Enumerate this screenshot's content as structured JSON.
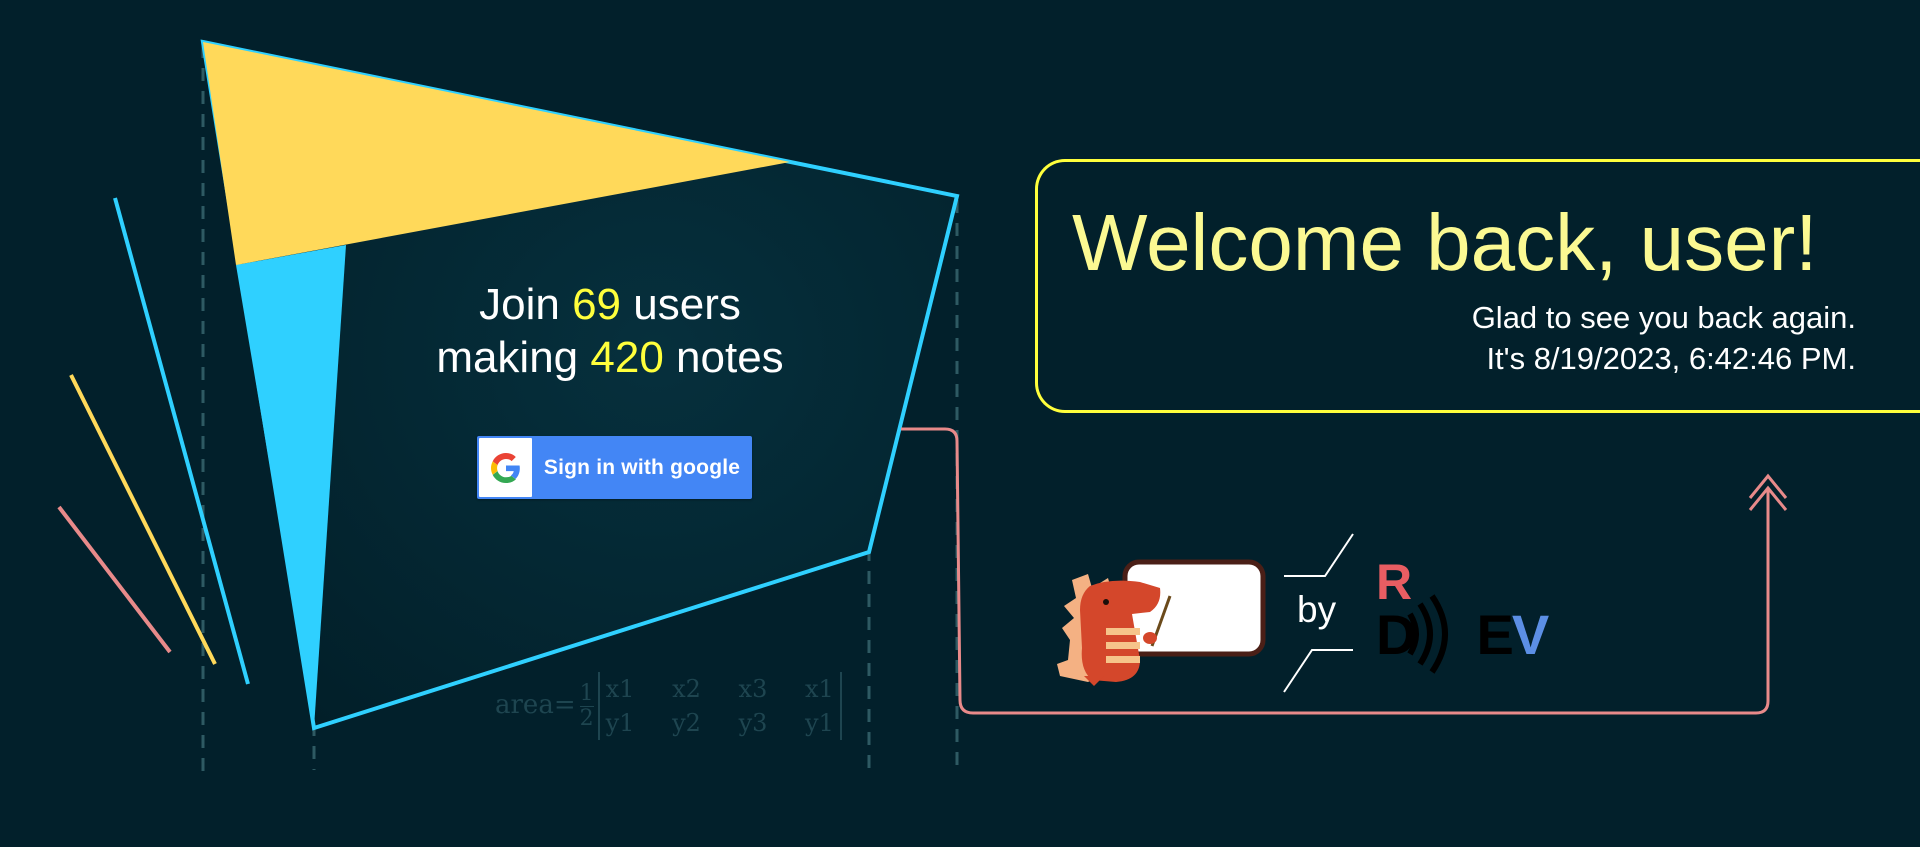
{
  "hero": {
    "join_prefix": "Join",
    "users_count": "69",
    "users_suffix": "users",
    "making_prefix": "making",
    "notes_count": "420",
    "notes_suffix": "notes"
  },
  "signin": {
    "label": "Sign in with google",
    "icon": "google-g-icon"
  },
  "welcome": {
    "title": "Welcome back, user!",
    "subtitle": "Glad to see you back again.",
    "datetime": "It's 8/19/2023, 6:42:46 PM."
  },
  "branding": {
    "by": "by",
    "logo_r": "R",
    "logo_d": "D",
    "logo_e": "E",
    "logo_v": "V",
    "mascot_icon": "dinosaur-whiteboard-icon"
  },
  "formula": {
    "label": "area",
    "equals": "=",
    "half_num": "1",
    "half_den": "2",
    "matrix_top": [
      "x1",
      "x2",
      "x3",
      "x1"
    ],
    "matrix_bottom": [
      "y1",
      "y2",
      "y3",
      "y1"
    ]
  },
  "colors": {
    "background": "#02202b",
    "accent_yellow": "#ffd95a",
    "accent_cyan": "#2fd0ff",
    "highlight_yellow": "#ffff3c",
    "title_yellow": "#fbf992",
    "pink_line": "#e88a8a",
    "google_blue": "#4386f5"
  }
}
